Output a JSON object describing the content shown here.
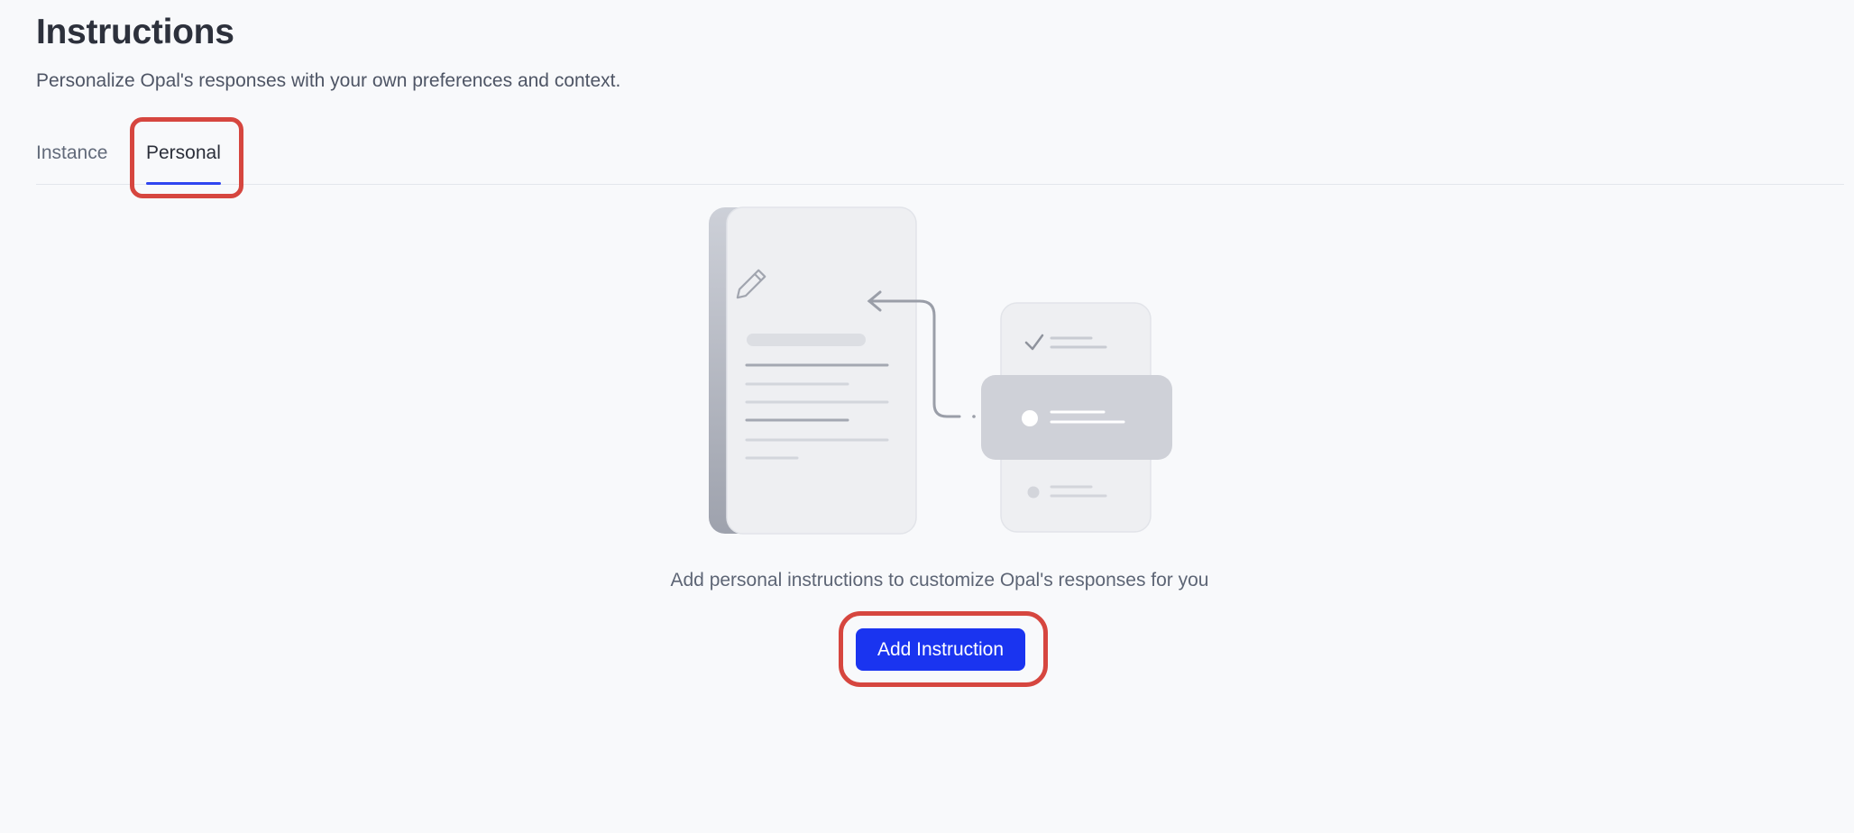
{
  "header": {
    "title": "Instructions",
    "subtitle": "Personalize Opal's responses with your own preferences and context."
  },
  "tabs": [
    {
      "label": "Instance",
      "active": false
    },
    {
      "label": "Personal",
      "active": true
    }
  ],
  "empty_state": {
    "message": "Add personal instructions to customize Opal's responses for you",
    "button_label": "Add Instruction"
  },
  "colors": {
    "accent": "#1a34f0",
    "tab_indicator": "#2f45f0",
    "highlight": "#d6463f",
    "background": "#f8f9fb"
  }
}
